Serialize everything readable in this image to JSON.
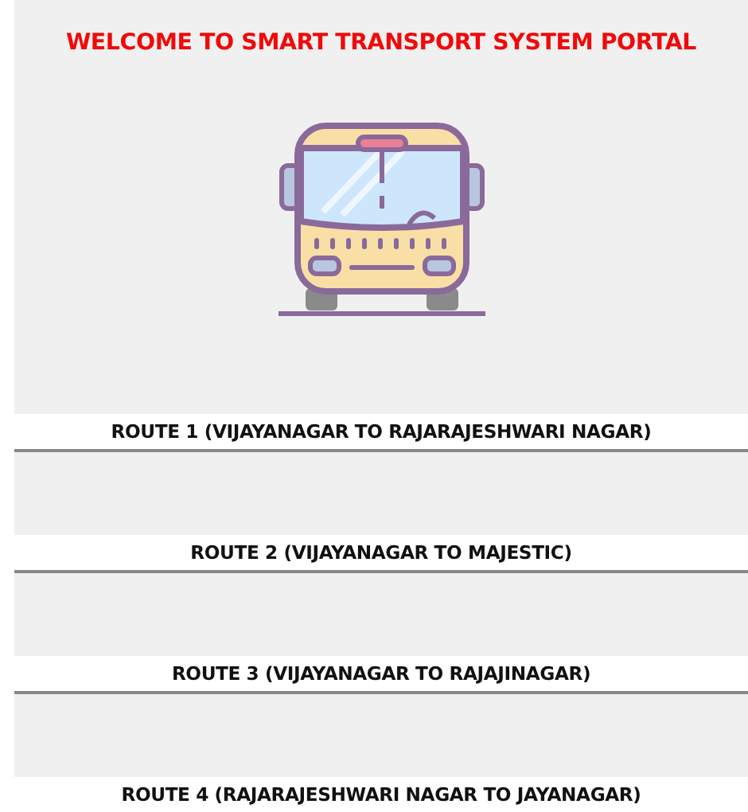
{
  "header": {
    "title": "WELCOME TO SMART TRANSPORT SYSTEM PORTAL"
  },
  "routes": [
    {
      "label": "ROUTE 1 (VIJAYANAGAR TO RAJARAJESHWARI NAGAR)"
    },
    {
      "label": "ROUTE 2 (VIJAYANAGAR TO MAJESTIC)"
    },
    {
      "label": "ROUTE 3 (VIJAYANAGAR TO RAJAJINAGAR)"
    },
    {
      "label": "ROUTE 4 (RAJARAJESHWARI NAGAR TO JAYANAGAR)"
    }
  ]
}
